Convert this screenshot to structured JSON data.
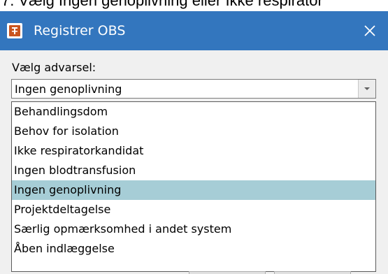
{
  "caption": {
    "text": "7. Vælg Ingen genoplivning eller Ikke respirator"
  },
  "dialog": {
    "title": "Registrer OBS",
    "app_icon": "app-icon",
    "close_icon": "close-icon",
    "titlebar_color": "#3376be"
  },
  "form": {
    "label": "Vælg advarsel:",
    "selected_value": "Ingen genoplivning",
    "dropdown_icon": "chevron-down-icon",
    "options": [
      "Behandlingsdom",
      "Behov for isolation",
      "Ikke respiratorkandidat",
      "Ingen blodtransfusion",
      "Ingen genoplivning",
      "Projektdeltagelse",
      "Særlig opmærksomhed i andet system",
      "Åben indlæggelse"
    ],
    "highlighted_option": "Ingen genoplivning",
    "highlight_color": "#a6cdd6"
  }
}
